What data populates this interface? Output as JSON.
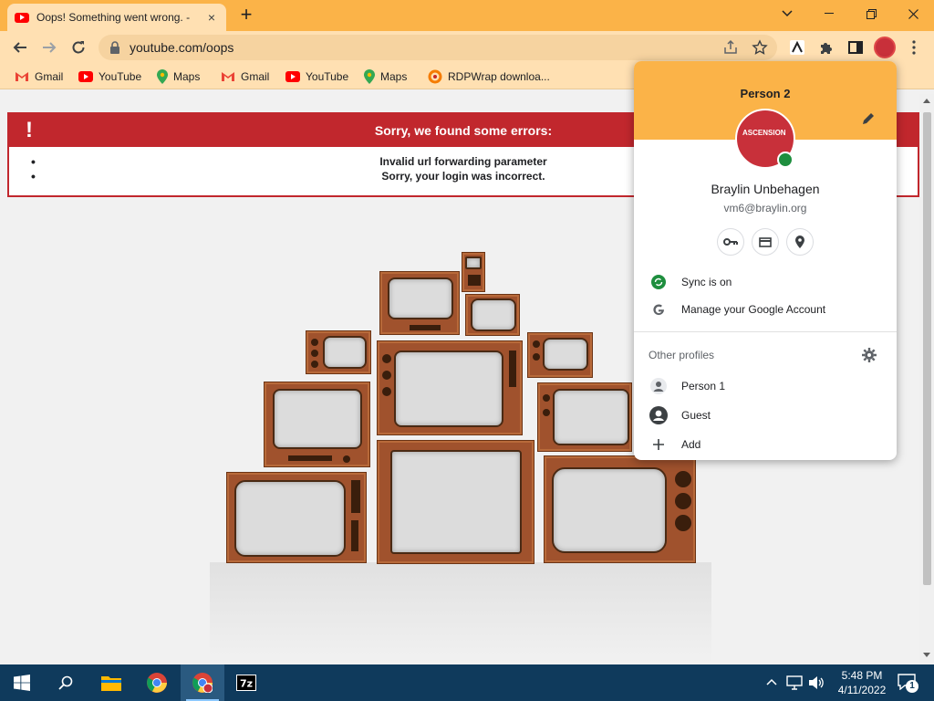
{
  "window": {
    "tab_title": "Oops! Something went wrong. -",
    "tab_close": "×",
    "new_tab": "+"
  },
  "toolbar": {
    "url": "youtube.com/oops"
  },
  "bookmarks": [
    {
      "label": "Gmail",
      "icon": "gmail-icon"
    },
    {
      "label": "YouTube",
      "icon": "youtube-icon"
    },
    {
      "label": "Maps",
      "icon": "maps-icon"
    },
    {
      "label": "Gmail",
      "icon": "gmail-icon"
    },
    {
      "label": "YouTube",
      "icon": "youtube-icon"
    },
    {
      "label": "Maps",
      "icon": "maps-icon"
    },
    {
      "label": "RDPWrap downloa...",
      "icon": "rdpwrap-icon"
    }
  ],
  "error": {
    "icon_glyph": "!",
    "title": "Sorry, we found some errors:",
    "items": [
      "Invalid url forwarding parameter",
      "Sorry, your login was incorrect."
    ]
  },
  "profile": {
    "header": "Person 2",
    "name": "Braylin Unbehagen",
    "email": "vm6@braylin.org",
    "avatar_text": "ASCENSION",
    "sync": "Sync is on",
    "manage": "Manage your Google Account",
    "other_profiles": "Other profiles",
    "profiles": [
      {
        "label": "Person 1"
      },
      {
        "label": "Guest"
      },
      {
        "label": "Add"
      }
    ]
  },
  "taskbar": {
    "time": "5:48 PM",
    "date": "4/11/2022",
    "notification_count": "1"
  },
  "colors": {
    "titlebar": "#fbb348",
    "toolbar": "#ffe0b2",
    "error_red": "#c1272d",
    "taskbar": "#0f3a5c"
  }
}
